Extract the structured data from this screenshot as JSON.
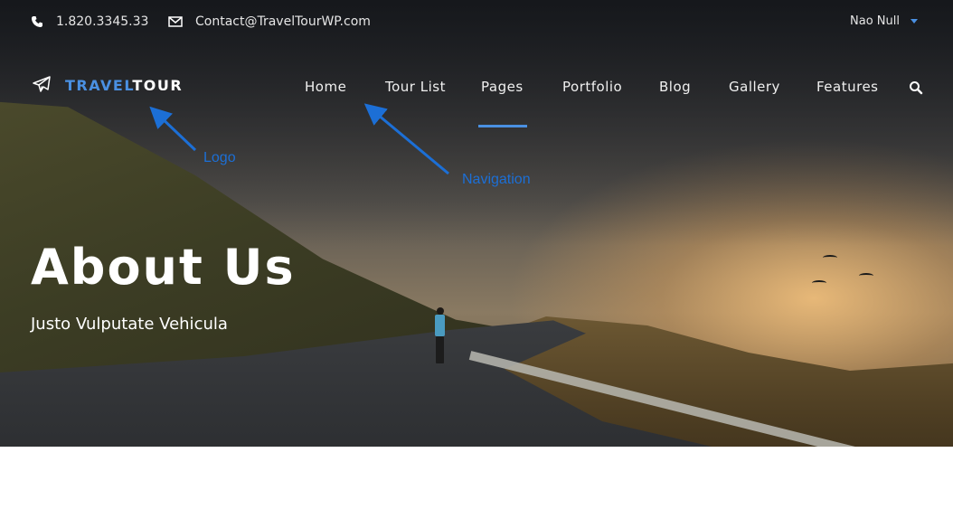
{
  "topbar": {
    "phone": "1.820.3345.33",
    "email": "Contact@TravelTourWP.com",
    "language": "Nao Null"
  },
  "logo": {
    "part1": "TRAVEL",
    "part2": "TOUR"
  },
  "nav": {
    "items": [
      {
        "label": "Home"
      },
      {
        "label": "Tour List"
      },
      {
        "label": "Pages"
      },
      {
        "label": "Portfolio"
      },
      {
        "label": "Blog"
      },
      {
        "label": "Gallery"
      },
      {
        "label": "Features"
      }
    ],
    "active": "Pages"
  },
  "annotations": {
    "logo": "Logo",
    "navigation": "Navigation"
  },
  "hero": {
    "title": "About Us",
    "subtitle": "Justo Vulputate Vehicula"
  },
  "colors": {
    "accent": "#4a90e2",
    "annotation": "#1c6fd6"
  },
  "icons": {
    "phone": "phone-icon",
    "email": "envelope-icon",
    "logo": "airplane-icon",
    "search": "search-icon",
    "dropdown": "caret-down-icon"
  }
}
